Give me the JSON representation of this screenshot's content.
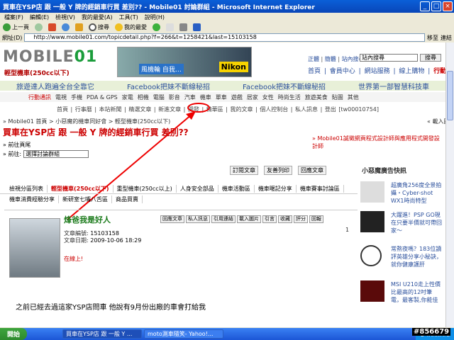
{
  "window": {
    "title": "買車在YSP店 跟 一般 Y 牌的經銷車行買 差別?? - Mobile01 討論群組 - Microsoft Internet Explorer",
    "watermark": "mobile01"
  },
  "menu": [
    "檔案(F)",
    "編輯(E)",
    "檢視(V)",
    "我的最愛(A)",
    "工具(T)",
    "說明(H)"
  ],
  "toolbar": {
    "back_label": "上一頁",
    "search_label": "搜尋",
    "favorites_label": "我的最愛"
  },
  "address": {
    "label": "網址(D)",
    "url": "http://www.mobile01.com/topicdetail.php?f=266&t=1258421&last=15103158",
    "go_label": "移至",
    "links_label": "連結"
  },
  "site": {
    "logo_prefix": "MOBILE",
    "logo_suffix": "01",
    "forum_name": "輕型機車(250cc以下)",
    "banner_text": "風機輪 自我…",
    "banner_brand": "Nikon",
    "top_links": [
      "正體",
      "簡體",
      "站內搜尋"
    ],
    "search_placeholder": "站內搜尋",
    "search_button": "搜尋",
    "right_nav": [
      "首頁",
      "會員中心",
      "網站服務",
      "線上購物",
      "行動上網"
    ],
    "promos": [
      "旅遊達人跑遍全台全靠它",
      "Facebook把妹不斷線秘招",
      "Facebook把妹不斷線秘招",
      "世界第一部智慧科技車"
    ],
    "categories": [
      "行動通訊",
      "電視",
      "手機",
      "PDA & GPS",
      "家電",
      "相機",
      "電腦",
      "影音",
      "汽車",
      "機車",
      "單車",
      "遊戲",
      "居家",
      "女性",
      "時尚生活",
      "旅遊美食",
      "貼圖",
      "其他"
    ],
    "subnav": [
      "首頁",
      "行事曆",
      "本站新聞",
      "精選文章",
      "新進文章",
      "開發",
      "精華區",
      "我的文章",
      "個人控制台",
      "私人訊息",
      "登出 [tw00010754]"
    ],
    "breadcrumb": "» Mobile01 首頁 > 小惡魔的機車同好會 > 輕型機車(250cc以下)",
    "download_note": "« 載入圖片",
    "headline": "買車在YSP店 跟 一般 Y 牌的經銷車行買 差別??",
    "side_notice": "» Mobile01誠徵網頁程式設計師與應用程式開發設計師",
    "prev_label": "» 前往頁尾",
    "goto_label": "» 前往:",
    "goto_select": "選擇討論群組",
    "btn_subscribe": "訂閱文章",
    "btn_print": "友善列印",
    "btn_reply": "回應文章"
  },
  "sidebar": {
    "head": "小惡魔廣告快訊",
    "items": [
      {
        "text": "超廣角256度全景拍攝・Cyber-shot WX1時尚特型"
      },
      {
        "text": "大躍進！PSP GO現在只要半價就可帶回家～"
      },
      {
        "text": "常熬夜嗎？183位讀評英雄分享小秘訣，就你健康護肝"
      },
      {
        "text": "MSI U210走上性價比最高的12吋筆電，最客製,你能佳"
      }
    ]
  },
  "forum_tabs": {
    "row1": [
      "檢視分區列表",
      "輕型機車(250cc以下)",
      "重型機車(250cc以上)",
      "人身安全部品",
      "機車活動區",
      "機車暱記分享",
      "機車賽事討論區"
    ],
    "row2": [
      "機車消費經驗分享",
      "新研室七嘴八舌區",
      "商品買賣"
    ],
    "selected_index": 1
  },
  "post": {
    "username": "烽爸我是好人",
    "meta_number_label": "文章編號:",
    "meta_number": "15103158",
    "meta_date_label": "文章日期:",
    "meta_date": "2009-10-06 18:29",
    "status": "在線上!",
    "actions": [
      "回應文章",
      "私人訊息",
      "引用連結",
      "載入圖片",
      "引言",
      "收藏",
      "評分",
      "回報"
    ],
    "page_num": "1",
    "body": "之前已經去過這家YSP店問車 他說有9月份出廠的車會打給我"
  },
  "taskbar": {
    "start": "開始",
    "tasks": [
      "買車在YSP店 跟 一般 Y ...",
      "moto測車隨笑- Yahoo!..."
    ],
    "tray_label": "網際網路",
    "post_id": "#856679"
  }
}
